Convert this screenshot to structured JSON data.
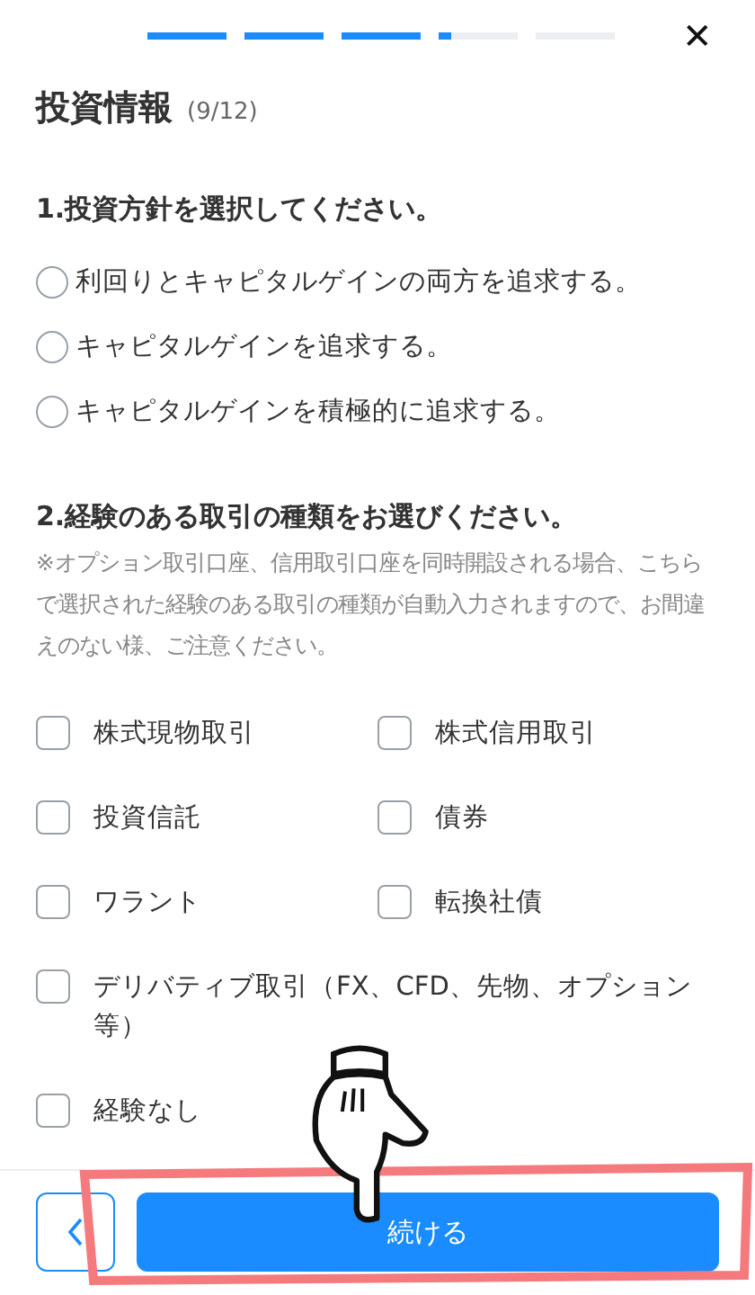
{
  "progress": {
    "level": 0.65
  },
  "close_icon": "✕",
  "title": "投資情報",
  "step_count": "(9/12)",
  "question_1": {
    "label": "1.投資方針を選択してください。",
    "options": [
      {
        "label": "利回りとキャピタルゲインの両方を追求する。",
        "selected": false
      },
      {
        "label": "キャピタルゲインを追求する。",
        "selected": false
      },
      {
        "label": "キャピタルゲインを積極的に追求する。",
        "selected": false
      }
    ]
  },
  "question_2": {
    "label": "2.経験のある取引の種類をお選びください。",
    "note": "※オプション取引口座、信用取引口座を同時開設される場合、こちらで選択された経験のある取引の種類が自動入力されますので、お間違えのない様、ご注意ください。",
    "rows": [
      [
        {
          "label": "株式現物取引",
          "checked": false
        },
        {
          "label": "株式信用取引",
          "checked": false
        }
      ],
      [
        {
          "label": "投資信託",
          "checked": false
        },
        {
          "label": "債券",
          "checked": false
        }
      ],
      [
        {
          "label": "ワラント",
          "checked": false
        },
        {
          "label": "転換社債",
          "checked": false
        }
      ],
      [
        {
          "label": "デリバティブ取引（FX、CFD、先物、オプション等）",
          "checked": false
        }
      ],
      [
        {
          "label": "経験なし",
          "checked": false
        }
      ]
    ]
  },
  "footer": {
    "continue_label": "続ける"
  }
}
